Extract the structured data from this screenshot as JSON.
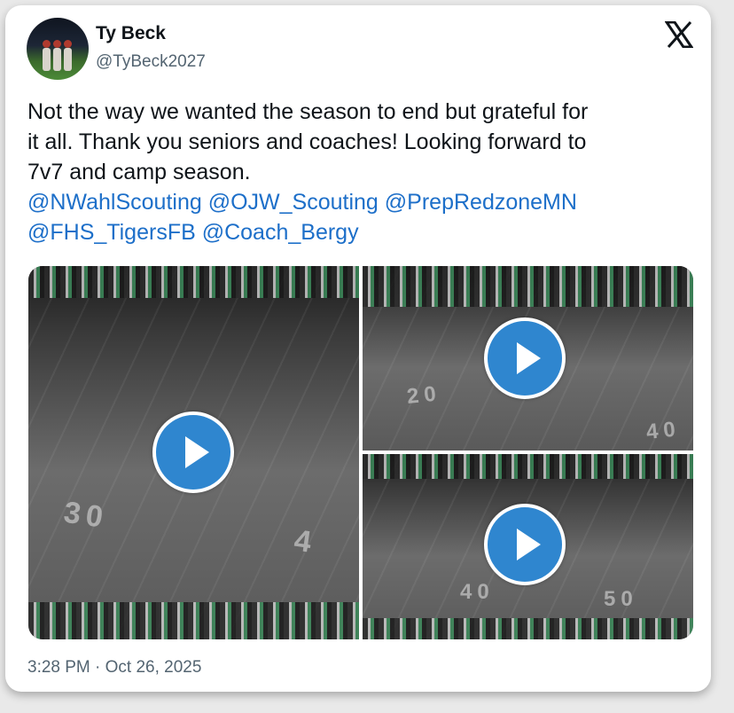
{
  "author": {
    "name": "Ty Beck",
    "handle": "@TyBeck2027"
  },
  "brand_icon": "x-logo-icon",
  "tweet": {
    "text_lines": [
      "Not the way we wanted the season to end but grateful for",
      "it all. Thank you seniors and coaches! Looking forward to",
      "7v7 and camp season."
    ],
    "mentions": [
      "@NWahlScouting",
      "@OJW_Scouting",
      "@PrepRedzoneMN",
      "@FHS_TigersFB",
      "@Coach_Bergy"
    ]
  },
  "media": {
    "videos": [
      {
        "yard_label": "30",
        "yard_label_b": "4"
      },
      {
        "yard_label": "20",
        "yard_label_b": "40"
      },
      {
        "yard_label": "40",
        "yard_label_b": "50"
      }
    ],
    "play_icon": "play-icon"
  },
  "timestamp": "3:28 PM · Oct 26, 2025",
  "colors": {
    "mention": "#1d6fc9",
    "play_button": "#2f86cf",
    "text": "#0f1419",
    "muted": "#536471"
  }
}
